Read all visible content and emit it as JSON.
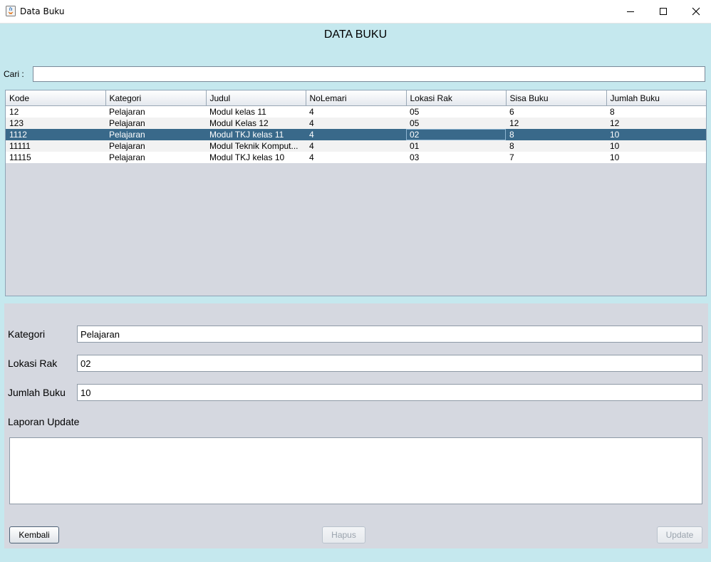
{
  "window": {
    "title": "Data Buku"
  },
  "page": {
    "heading": "DATA BUKU"
  },
  "search": {
    "label": "Cari :",
    "value": ""
  },
  "table": {
    "columns": [
      "Kode",
      "Kategori",
      "Judul",
      "NoLemari",
      "Lokasi Rak",
      "Sisa Buku",
      "Jumlah Buku"
    ],
    "rows": [
      [
        "12",
        "Pelajaran",
        "Modul kelas 11",
        "4",
        "05",
        "6",
        "8"
      ],
      [
        "123",
        "Pelajaran",
        "Modul Kelas 12",
        "4",
        "05",
        "12",
        "12"
      ],
      [
        "1112",
        "Pelajaran",
        "Modul TKJ kelas 11",
        "4",
        "02",
        "8",
        "10"
      ],
      [
        "11111",
        "Pelajaran",
        "Modul Teknik Komput...",
        "4",
        "01",
        "8",
        "10"
      ],
      [
        "11115",
        "Pelajaran",
        "Modul TKJ kelas 10",
        "4",
        "03",
        "7",
        "10"
      ]
    ],
    "selected_row": 2
  },
  "form": {
    "kategori_label": "Kategori",
    "kategori_value": "Pelajaran",
    "lokasi_label": "Lokasi Rak",
    "lokasi_value": "02",
    "jumlah_label": "Jumlah Buku",
    "jumlah_value": "10",
    "laporan_label": "Laporan Update",
    "laporan_value": ""
  },
  "buttons": {
    "kembali": "Kembali",
    "hapus": "Hapus",
    "update": "Update"
  }
}
